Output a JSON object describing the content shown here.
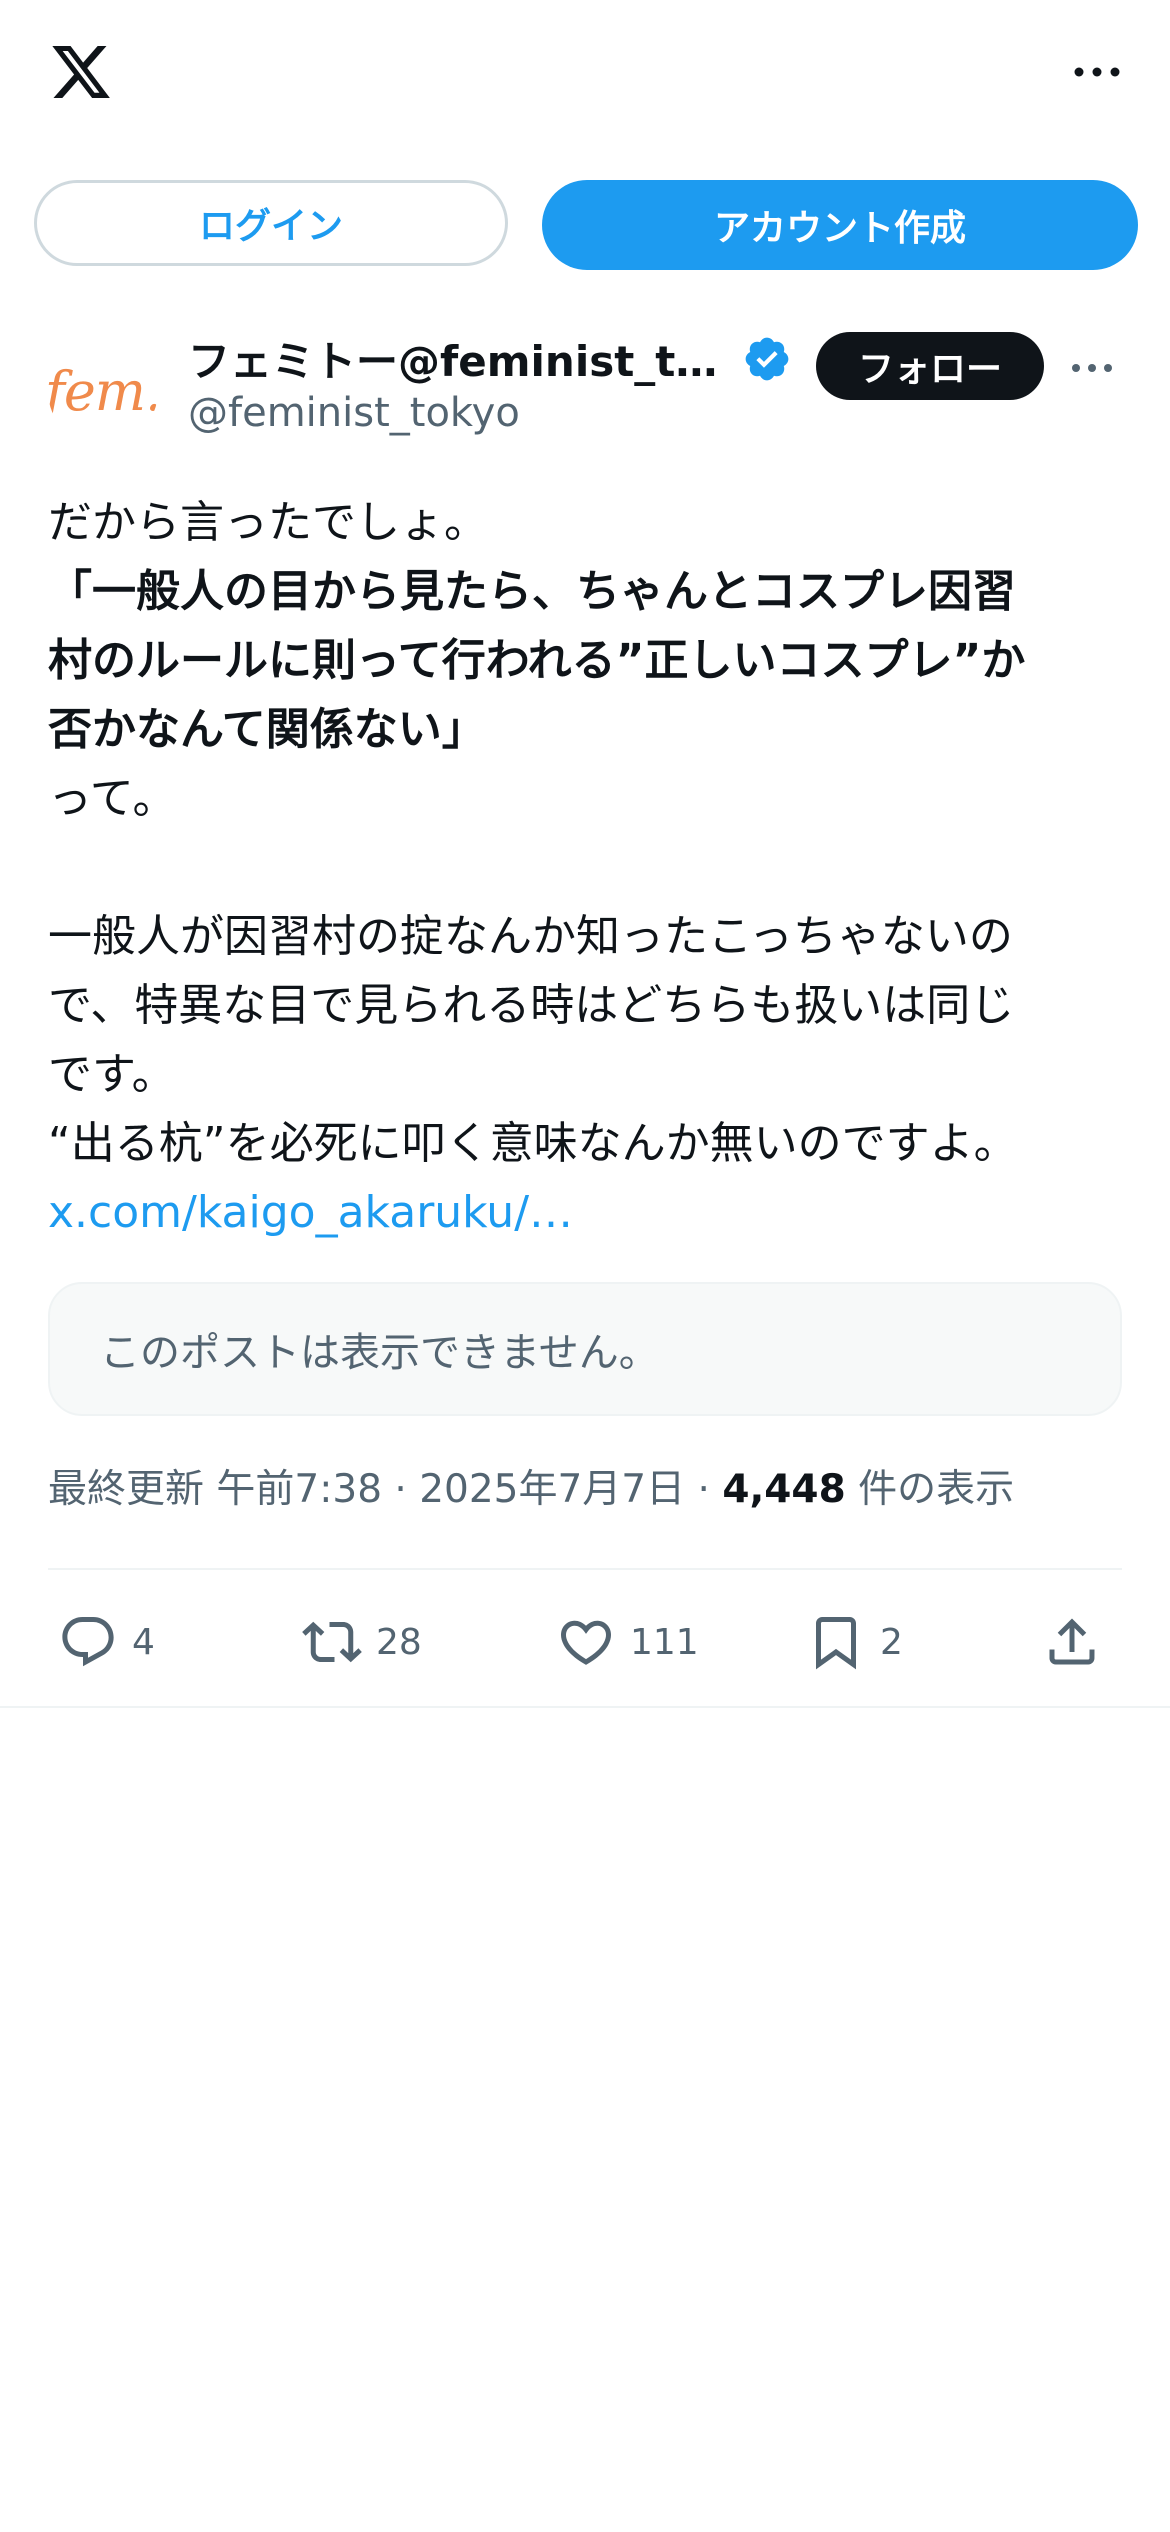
{
  "header": {
    "logo_icon": "x-logo-icon",
    "more_icon": "more-horizontal-icon"
  },
  "auth": {
    "login_label": "ログイン",
    "signup_label": "アカウント作成"
  },
  "author": {
    "avatar_text": "fem.",
    "display_name": "フェミトー@feminist_tokyo",
    "handle": "@feminist_tokyo",
    "verified_icon": "verified-badge-icon",
    "follow_label": "フォロー"
  },
  "tweet": {
    "line1": "だから言ったでしょ。",
    "bold_line1": "「一般人の目から見たら、ちゃんとコスプレ因習",
    "bold_line2": "村のルールに則って行われる”正しいコスプレ”か",
    "bold_line3": "否かなんて関係ない」",
    "line2": "って。",
    "para2_line1": "一般人が因習村の掟なんか知ったこっちゃないの",
    "para2_line2": "で、特異な目で見られる時はどちらも扱いは同じ",
    "para2_line3": "です。",
    "para2_line4": "“出る杭”を必死に叩く意味なんか無いのですよ。",
    "link_text": "x.com/kaigo_akaruku/…"
  },
  "quote": {
    "unavailable_text": "このポストは表示できません。"
  },
  "meta": {
    "updated_prefix": "最終更新",
    "time": "午前7:38",
    "separator": "·",
    "date": "2025年7月7日",
    "views_count": "4,448",
    "views_label": "件の表示"
  },
  "actions": {
    "replies": "4",
    "retweets": "28",
    "likes": "111",
    "bookmarks": "2"
  },
  "colors": {
    "accent": "#1d9bf0",
    "text_primary": "#0f1419",
    "text_secondary": "#536471",
    "avatar_brand": "#f08a4b"
  }
}
